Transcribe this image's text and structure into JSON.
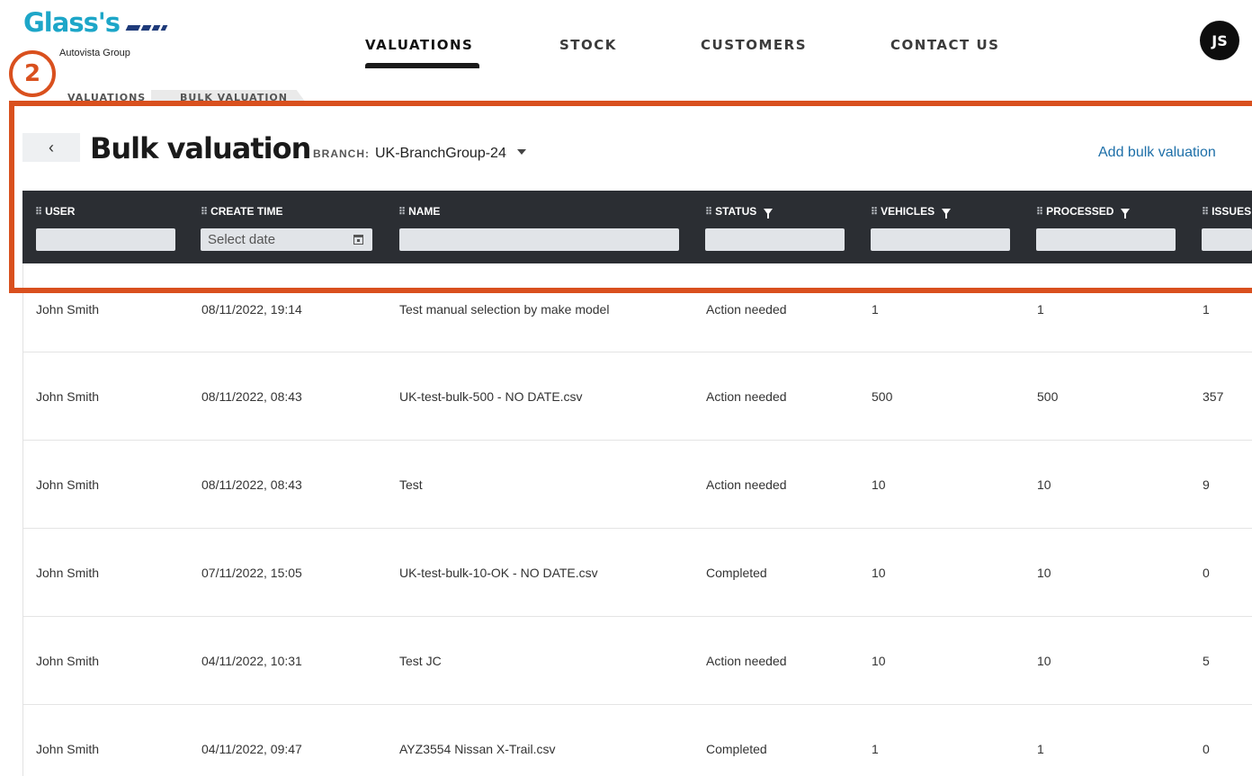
{
  "brand": {
    "name": "Glass's",
    "tagline": "Autovista Group",
    "primary": "#1da6c8",
    "accent_dots": "#1f3b7a"
  },
  "nav": {
    "items": [
      {
        "label": "VALUATIONS",
        "active": true
      },
      {
        "label": "STOCK",
        "active": false
      },
      {
        "label": "CUSTOMERS",
        "active": false
      },
      {
        "label": "CONTACT US",
        "active": false
      }
    ]
  },
  "user": {
    "initials": "JS"
  },
  "annotation": {
    "step": "2",
    "color": "#d9501e"
  },
  "breadcrumb": [
    "VALUATIONS",
    "BULK VALUATION"
  ],
  "page": {
    "back_icon": "chevron-left-icon",
    "title": "Bulk valuation",
    "branch_label": "BRANCH:",
    "branch_value": "UK-BranchGroup-24",
    "add_link": "Add bulk valuation"
  },
  "table": {
    "columns": [
      {
        "key": "user",
        "label": "USER",
        "filter_icon": false
      },
      {
        "key": "create_time",
        "label": "CREATE TIME",
        "filter_icon": false
      },
      {
        "key": "name",
        "label": "NAME",
        "filter_icon": false
      },
      {
        "key": "status",
        "label": "STATUS",
        "filter_icon": true
      },
      {
        "key": "vehicles",
        "label": "VEHICLES",
        "filter_icon": true
      },
      {
        "key": "processed",
        "label": "PROCESSED",
        "filter_icon": true
      },
      {
        "key": "issues",
        "label": "ISSUES",
        "filter_icon": false
      }
    ],
    "date_placeholder": "Select date",
    "rows": [
      {
        "user": "John Smith",
        "create_time": "08/11/2022, 19:14",
        "name": "Test manual selection by make model",
        "status": "Action needed",
        "vehicles": "1",
        "processed": "1",
        "issues": "1"
      },
      {
        "user": "John Smith",
        "create_time": "08/11/2022, 08:43",
        "name": "UK-test-bulk-500 - NO DATE.csv",
        "status": "Action needed",
        "vehicles": "500",
        "processed": "500",
        "issues": "357"
      },
      {
        "user": "John Smith",
        "create_time": "08/11/2022, 08:43",
        "name": "Test",
        "status": "Action needed",
        "vehicles": "10",
        "processed": "10",
        "issues": "9"
      },
      {
        "user": "John Smith",
        "create_time": "07/11/2022, 15:05",
        "name": "UK-test-bulk-10-OK - NO DATE.csv",
        "status": "Completed",
        "vehicles": "10",
        "processed": "10",
        "issues": "0"
      },
      {
        "user": "John Smith",
        "create_time": "04/11/2022, 10:31",
        "name": "Test JC",
        "status": "Action needed",
        "vehicles": "10",
        "processed": "10",
        "issues": "5"
      },
      {
        "user": "John Smith",
        "create_time": "04/11/2022, 09:47",
        "name": "AYZ3554 Nissan X-Trail.csv",
        "status": "Completed",
        "vehicles": "1",
        "processed": "1",
        "issues": "0"
      }
    ]
  }
}
